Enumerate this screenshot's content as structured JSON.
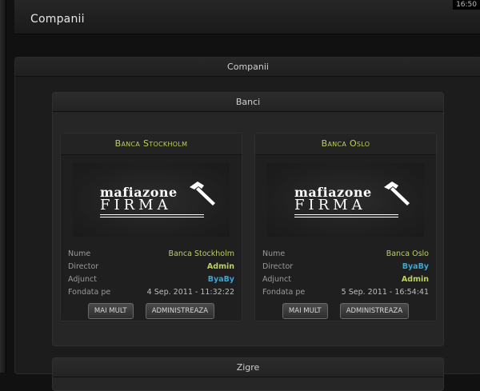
{
  "header": {
    "title": "Companii",
    "clock": "16:50"
  },
  "main": {
    "title": "Companii",
    "sections": {
      "banci": {
        "title": "Banci"
      },
      "zigre": {
        "title": "Zigre"
      }
    }
  },
  "logo": {
    "top": "mafiazone",
    "bottom": "FIRMA",
    "icon": "hammer-icon"
  },
  "colors": {
    "accent_green": "#b9d25a",
    "accent_blue": "#39a6d8"
  },
  "banks": [
    {
      "title": "Banca Stockholm",
      "rows": [
        {
          "label": "Nume",
          "value": "Banca Stockholm"
        },
        {
          "label": "Director",
          "value": "Admin"
        },
        {
          "label": "Adjunct",
          "value": "ByaBy"
        },
        {
          "label": "Fondata pe",
          "value": "4 Sep. 2011 - 11:32:22"
        }
      ],
      "buttons": {
        "more": "MAI MULT",
        "admin": "ADMINISTREAZA"
      }
    },
    {
      "title": "Banca Oslo",
      "rows": [
        {
          "label": "Nume",
          "value": "Banca Oslo"
        },
        {
          "label": "Director",
          "value": "ByaBy"
        },
        {
          "label": "Adjunct",
          "value": "Admin"
        },
        {
          "label": "Fondata pe",
          "value": "5 Sep. 2011 - 16:54:41"
        }
      ],
      "buttons": {
        "more": "MAI MULT",
        "admin": "ADMINISTREAZA"
      }
    }
  ]
}
